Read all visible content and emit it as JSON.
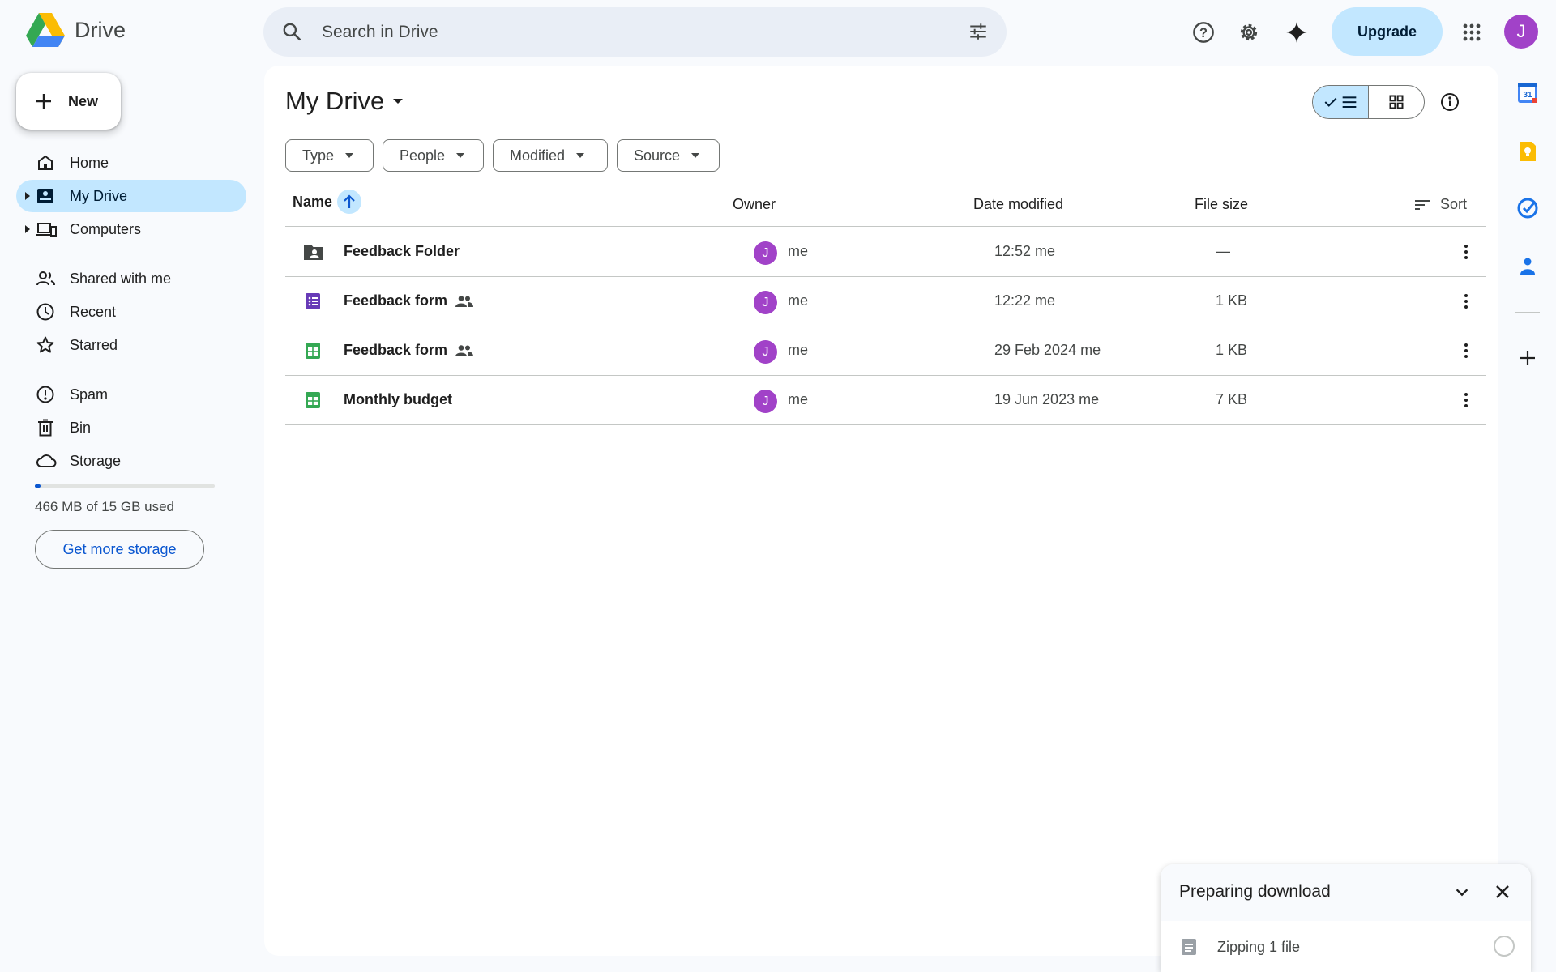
{
  "app": {
    "name": "Drive"
  },
  "search": {
    "placeholder": "Search in Drive"
  },
  "header": {
    "upgrade_label": "Upgrade",
    "avatar_initial": "J",
    "icons": [
      "help-icon",
      "settings-icon",
      "gemini-icon",
      "apps-grid-icon"
    ]
  },
  "sidebar": {
    "new_label": "New",
    "items": [
      {
        "label": "Home",
        "icon": "home-icon",
        "active": false
      },
      {
        "label": "My Drive",
        "icon": "my-drive-icon",
        "active": true
      },
      {
        "label": "Computers",
        "icon": "computers-icon",
        "active": false
      },
      {
        "label": "Shared with me",
        "icon": "shared-icon",
        "active": false
      },
      {
        "label": "Recent",
        "icon": "clock-icon",
        "active": false
      },
      {
        "label": "Starred",
        "icon": "star-icon",
        "active": false
      },
      {
        "label": "Spam",
        "icon": "spam-icon",
        "active": false
      },
      {
        "label": "Bin",
        "icon": "bin-icon",
        "active": false
      },
      {
        "label": "Storage",
        "icon": "cloud-icon",
        "active": false
      }
    ],
    "storage": {
      "used_text": "466 MB of 15 GB used",
      "used_fraction": 0.03,
      "more_label": "Get more storage"
    }
  },
  "main": {
    "title": "My Drive",
    "filters": [
      "Type",
      "People",
      "Modified",
      "Source"
    ],
    "columns": {
      "name": "Name",
      "owner": "Owner",
      "date": "Date modified",
      "size": "File size",
      "sort": "Sort"
    },
    "files": [
      {
        "name": "Feedback Folder",
        "type": "shared-folder-icon",
        "shared": false,
        "owner_initial": "J",
        "owner": "me",
        "date": "12:52 me",
        "size": "—"
      },
      {
        "name": "Feedback form",
        "type": "forms-icon",
        "shared": true,
        "owner_initial": "J",
        "owner": "me",
        "date": "12:22 me",
        "size": "1 KB"
      },
      {
        "name": "Feedback form",
        "type": "sheets-icon",
        "shared": true,
        "owner_initial": "J",
        "owner": "me",
        "date": "29 Feb 2024 me",
        "size": "1 KB"
      },
      {
        "name": "Monthly budget",
        "type": "sheets-icon",
        "shared": false,
        "owner_initial": "J",
        "owner": "me",
        "date": "19 Jun 2023 me",
        "size": "7 KB"
      }
    ]
  },
  "side_panel": {
    "calendar_day": "31",
    "icons": [
      "calendar-icon",
      "keep-icon",
      "tasks-icon",
      "contacts-icon",
      "add-icon"
    ]
  },
  "download": {
    "title": "Preparing download",
    "status": "Zipping 1 file"
  },
  "colors": {
    "accent": "#0b57d0",
    "selected": "#c2e7ff",
    "avatar": "#a142c8",
    "forms": "#673ab7",
    "sheets": "#34a853"
  }
}
